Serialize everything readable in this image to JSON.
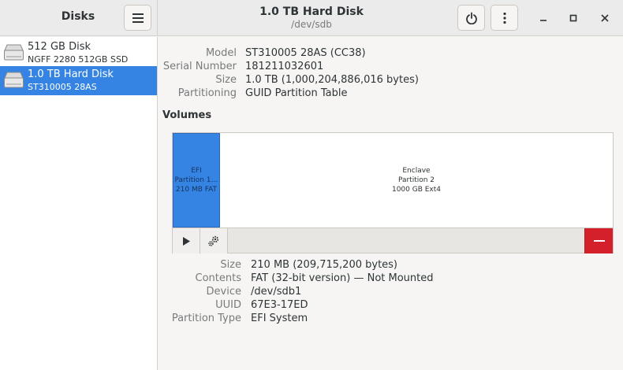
{
  "app": {
    "title": "Disks"
  },
  "header": {
    "title": "1.0 TB Hard Disk",
    "subtitle": "/dev/sdb"
  },
  "sidebar": {
    "items": [
      {
        "name": "512 GB Disk",
        "description": "NGFF 2280 512GB SSD",
        "selected": false
      },
      {
        "name": "1.0 TB Hard Disk",
        "description": "ST310005 28AS",
        "selected": true
      }
    ]
  },
  "disk_info": {
    "model_label": "Model",
    "model": "ST310005 28AS (CC38)",
    "serial_label": "Serial Number",
    "serial": "181211032601",
    "size_label": "Size",
    "size": "1.0 TB (1,000,204,886,016 bytes)",
    "partitioning_label": "Partitioning",
    "partitioning": "GUID Partition Table"
  },
  "volumes": {
    "heading": "Volumes",
    "segments": [
      {
        "line1": "EFI",
        "line2": "Partition 1…",
        "line3": "210 MB FAT",
        "selected": true
      },
      {
        "line1": "Enclave",
        "line2": "Partition 2",
        "line3": "1000 GB Ext4",
        "selected": false
      }
    ]
  },
  "partition_info": {
    "size_label": "Size",
    "size": "210 MB (209,715,200 bytes)",
    "contents_label": "Contents",
    "contents": "FAT (32-bit version) — Not Mounted",
    "device_label": "Device",
    "device": "/dev/sdb1",
    "uuid_label": "UUID",
    "uuid": "67E3-17ED",
    "type_label": "Partition Type",
    "type": "EFI System"
  },
  "colors": {
    "accent": "#3584e4",
    "destructive": "#d4202a"
  },
  "icons": {
    "menu": "hamburger-menu-icon",
    "power": "power-icon",
    "more": "vertical-ellipsis-icon",
    "minimize": "minimize-icon",
    "maximize": "maximize-icon",
    "close": "close-icon",
    "disk": "hard-disk-icon",
    "mount": "play-icon",
    "settings": "gears-icon",
    "delete": "minus-icon"
  }
}
